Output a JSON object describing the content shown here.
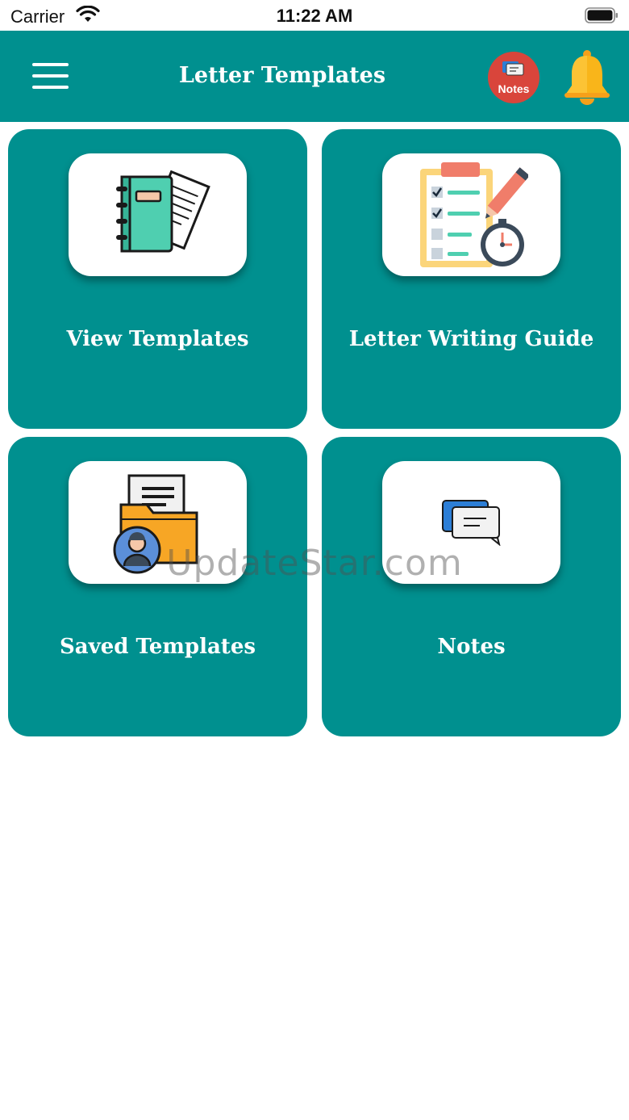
{
  "status_bar": {
    "carrier": "Carrier",
    "time": "11:22 AM",
    "icons": [
      "wifi-icon",
      "battery-icon"
    ]
  },
  "header": {
    "title": "Letter Templates",
    "notes_badge_label": "Notes",
    "icons": [
      "hamburger-menu-icon",
      "notes-icon",
      "bell-icon"
    ],
    "background_color": "#00908f"
  },
  "tiles": [
    {
      "label": "View Templates",
      "icon": "notebook-icon"
    },
    {
      "label": "Letter Writing Guide",
      "icon": "clipboard-checklist-icon"
    },
    {
      "label": "Saved Templates",
      "icon": "user-folder-icon"
    },
    {
      "label": "Notes",
      "icon": "chat-bubbles-icon"
    }
  ],
  "watermark": "UpdateStar.com",
  "colors": {
    "primary": "#00908f",
    "notes_badge": "#d9453b",
    "bell": "#f9b51a"
  }
}
